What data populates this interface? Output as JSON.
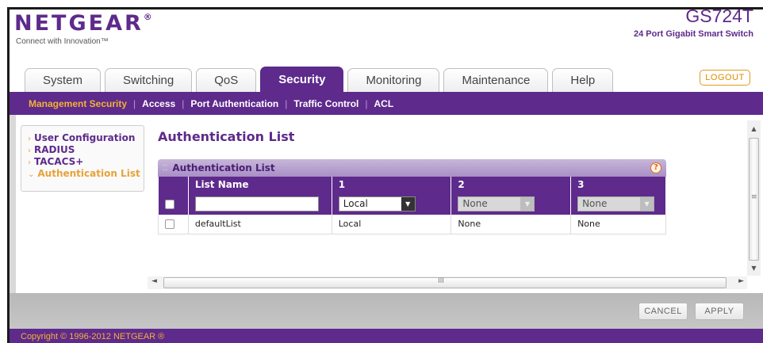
{
  "header": {
    "logo": "NETGEAR",
    "logo_mark": "®",
    "tagline": "Connect with Innovation™",
    "model": "GS724T",
    "model_description": "24 Port Gigabit Smart Switch",
    "logout_label": "LOGOUT"
  },
  "tabs": [
    {
      "label": "System"
    },
    {
      "label": "Switching"
    },
    {
      "label": "QoS"
    },
    {
      "label": "Security",
      "active": true
    },
    {
      "label": "Monitoring"
    },
    {
      "label": "Maintenance"
    },
    {
      "label": "Help"
    }
  ],
  "subnav": [
    {
      "label": "Management Security",
      "active": true
    },
    {
      "label": "Access"
    },
    {
      "label": "Port Authentication"
    },
    {
      "label": "Traffic Control"
    },
    {
      "label": "ACL"
    }
  ],
  "subnav_separator": "|",
  "sidebar": {
    "items": [
      {
        "label": "User Configuration"
      },
      {
        "label": "RADIUS"
      },
      {
        "label": "TACACS+"
      },
      {
        "label": "Authentication List",
        "active": true
      }
    ]
  },
  "page_title": "Authentication List",
  "panel": {
    "title": "Authentication List",
    "help_icon": "?"
  },
  "table": {
    "headers": [
      "",
      "List Name",
      "1",
      "2",
      "3"
    ],
    "edit_row": {
      "list_name_value": "",
      "method1": "Local",
      "method2": "None",
      "method3": "None"
    },
    "rows": [
      {
        "name": "defaultList",
        "m1": "Local",
        "m2": "None",
        "m3": "None"
      }
    ]
  },
  "scrollbar": {
    "up_arrow": "▲",
    "down_arrow": "▼",
    "left_arrow": "◄",
    "right_arrow": "►",
    "grip_vertical": "≡",
    "grip_horizontal": "III"
  },
  "buttons": {
    "cancel": "CANCEL",
    "apply": "APPLY"
  },
  "footer": "Copyright © 1996-2012 NETGEAR ®",
  "colors": {
    "brand_purple": "#5e2a8c",
    "accent_orange": "#f2b233"
  },
  "icons": {
    "sidebar_arrow": "chevron-right-icon",
    "sidebar_active_arrow": "chevron-down-icon",
    "help": "help-icon",
    "dropdown": "chevron-down-icon"
  }
}
